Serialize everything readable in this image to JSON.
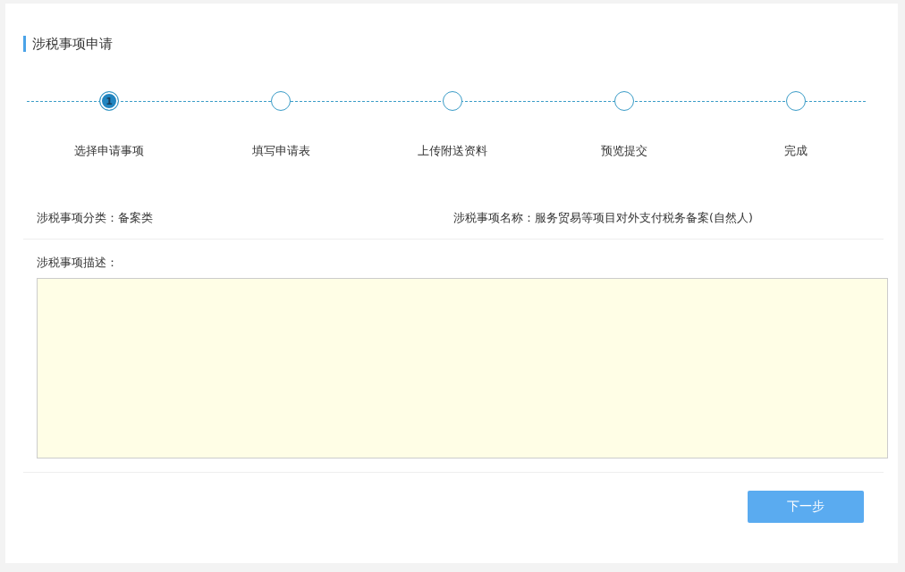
{
  "title": "涉税事项申请",
  "steps": [
    {
      "label": "选择申请事项",
      "number": "1",
      "selected": true
    },
    {
      "label": "填写申请表",
      "selected": false
    },
    {
      "label": "上传附送资料",
      "selected": false
    },
    {
      "label": "预览提交",
      "selected": false
    },
    {
      "label": "完成",
      "selected": false
    }
  ],
  "category": "涉税事项分类：备案类",
  "item_name": "涉税事项名称：服务贸易等项目对外支付税务备案(自然人)",
  "description": {
    "label": "涉税事项描述："
  },
  "buttons": [
    "下一步"
  ]
}
